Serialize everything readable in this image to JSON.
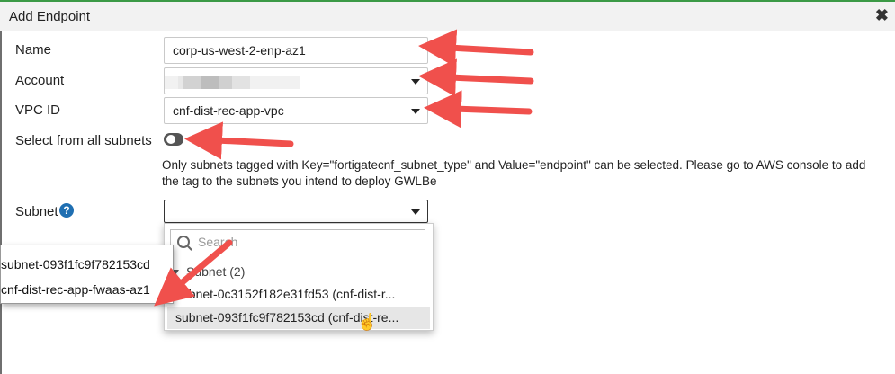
{
  "dialog": {
    "title": "Add Endpoint",
    "close_glyph": "✖"
  },
  "form": {
    "name_label": "Name",
    "name_value": "corp-us-west-2-enp-az1",
    "account_label": "Account",
    "vpc_label": "VPC ID",
    "vpc_value": "cnf-dist-rec-app-vpc",
    "all_subnets_label": "Select from all subnets",
    "all_subnets_on": false,
    "note": "Only subnets tagged with Key=\"fortigatecnf_subnet_type\" and Value=\"endpoint\" can be selected. Please go to AWS console to add the tag to the subnets you intend to deploy GWLBe",
    "subnet_label": "Subnet",
    "help_glyph": "?"
  },
  "dropdown": {
    "search_placeholder": "Search",
    "group_label": "Subnet  (2)",
    "options": [
      "subnet-0c3152f182e31fd53 (cnf-dist-r...",
      "subnet-093f1fc9f782153cd (cnf-dist-re..."
    ]
  },
  "tooltip": {
    "line1": "subnet-093f1fc9f782153cd",
    "line2": "cnf-dist-rec-app-fwaas-az1"
  },
  "colors": {
    "accent": "#f0504c",
    "help": "#1f6fb2",
    "topline": "#3c9a46"
  },
  "icons": {
    "search": "magnifier-icon",
    "cursor": "pointer-hand-icon"
  }
}
